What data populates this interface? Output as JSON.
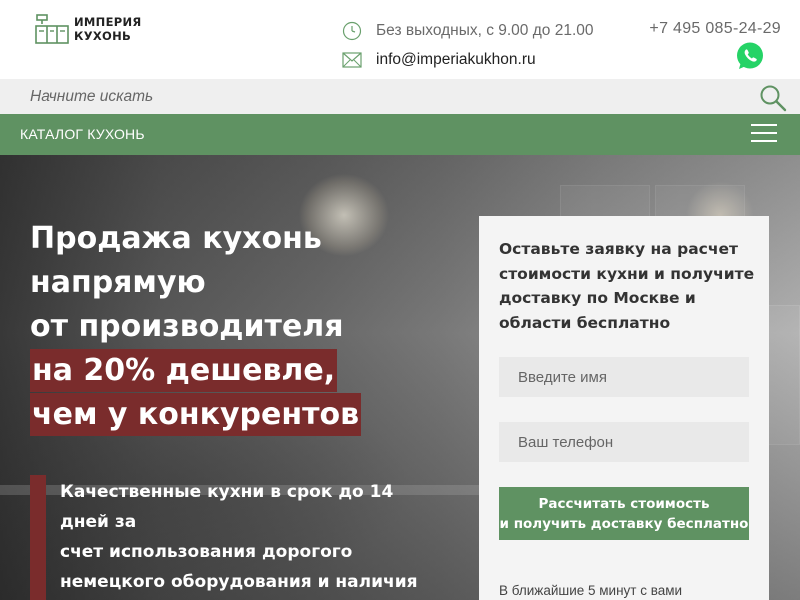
{
  "header": {
    "logo_line1": "ИМПЕРИЯ",
    "logo_line2": "КУХОНЬ",
    "hours": "Без выходных, с 9.00 до 21.00",
    "email": "info@imperiakukhon.ru",
    "phone": "+7 495 085-24-29",
    "icons": [
      "clock-icon",
      "mail-icon",
      "whatsapp-icon"
    ]
  },
  "search": {
    "placeholder": "Начните искать",
    "icon": "search-icon"
  },
  "catalog": {
    "label": "КАТАЛОГ КУХОНЬ",
    "icon": "menu-icon"
  },
  "hero": {
    "title_lines": [
      "Продажа кухонь",
      "напрямую",
      "от производителя"
    ],
    "highlight_lines": [
      "на 20% дешевле,",
      "чем у конкурентов"
    ],
    "features": [
      "Качественные кухни в срок до 14",
      "дней за",
      "счет использования дорогого",
      "немецкого оборудования и наличия"
    ]
  },
  "form": {
    "title": "Оставьте заявку на расчет стоимости кухни и получите доставку по Москве и области бесплатно",
    "name_placeholder": "Введите имя",
    "phone_placeholder": "Ваш телефон",
    "button_line1": "Рассчитать стоимость",
    "button_line2": "и получить доставку бесплатно",
    "note": "В ближайшие 5 минут с вами"
  },
  "colors": {
    "accent_green": "#5f9262",
    "highlight_red": "#7a2c2c",
    "whatsapp_green": "#25d366"
  }
}
